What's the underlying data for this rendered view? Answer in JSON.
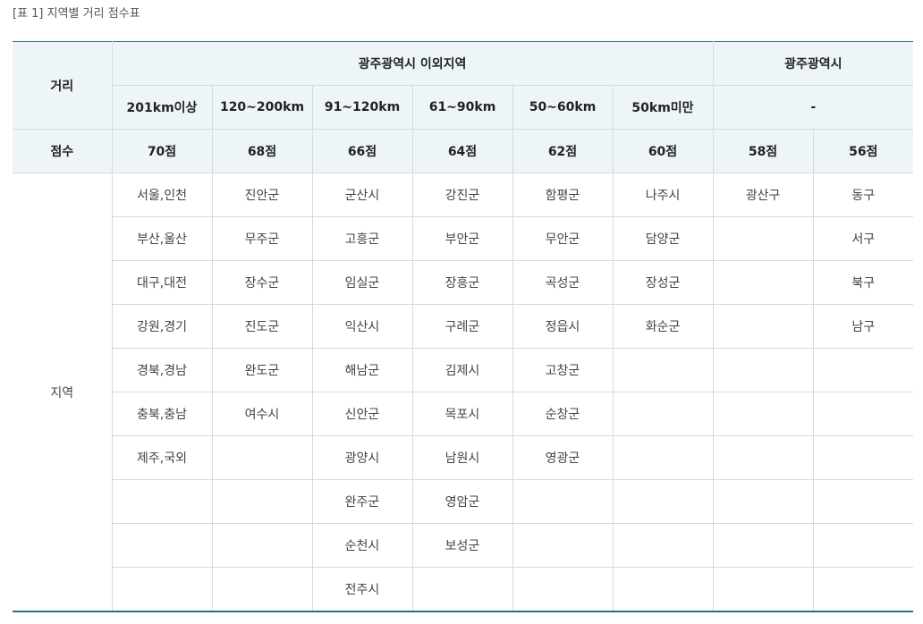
{
  "caption": "[표 1] 지역별 거리 점수표",
  "header": {
    "distance_label": "거리",
    "group_outside": "광주광역시 이외지역",
    "group_gwangju": "광주광역시",
    "distances": [
      "201km이상",
      "120~200km",
      "91~120km",
      "61~90km",
      "50~60km",
      "50km미만"
    ],
    "gwangju_distance": "-"
  },
  "score_row": {
    "label": "점수",
    "scores": [
      "70점",
      "68점",
      "66점",
      "64점",
      "62점",
      "60점",
      "58점",
      "56점"
    ]
  },
  "region": {
    "label": "지역",
    "rows": [
      [
        "서울,인천",
        "진안군",
        "군산시",
        "강진군",
        "함평군",
        "나주시",
        "광산구",
        "동구"
      ],
      [
        "부산,울산",
        "무주군",
        "고흥군",
        "부안군",
        "무안군",
        "담양군",
        "",
        "서구"
      ],
      [
        "대구,대전",
        "장수군",
        "임실군",
        "장흥군",
        "곡성군",
        "장성군",
        "",
        "북구"
      ],
      [
        "강원,경기",
        "진도군",
        "익산시",
        "구례군",
        "정읍시",
        "화순군",
        "",
        "남구"
      ],
      [
        "경북,경남",
        "완도군",
        "해남군",
        "김제시",
        "고창군",
        "",
        "",
        ""
      ],
      [
        "충북,충남",
        "여수시",
        "신안군",
        "목포시",
        "순창군",
        "",
        "",
        ""
      ],
      [
        "제주,국외",
        "",
        "광양시",
        "남원시",
        "영광군",
        "",
        "",
        ""
      ],
      [
        "",
        "",
        "완주군",
        "영암군",
        "",
        "",
        "",
        ""
      ],
      [
        "",
        "",
        "순천시",
        "보성군",
        "",
        "",
        "",
        ""
      ],
      [
        "",
        "",
        "전주시",
        "",
        "",
        "",
        "",
        ""
      ]
    ]
  }
}
